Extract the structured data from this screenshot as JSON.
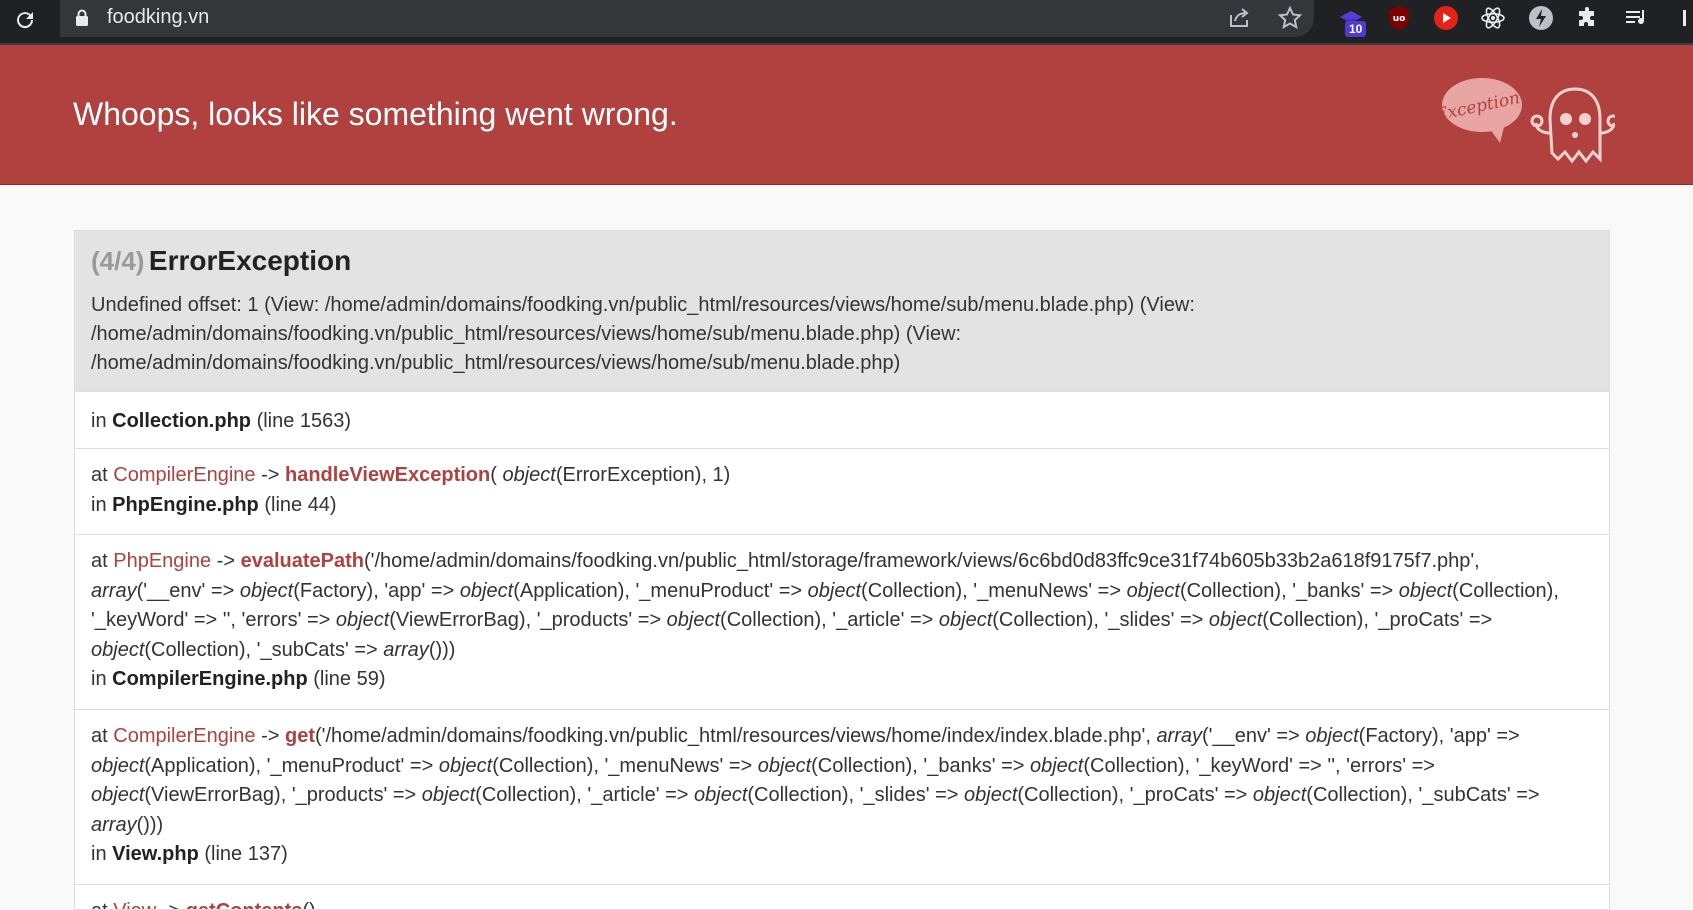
{
  "browser": {
    "url": "foodking.vn",
    "extension_badge": "10"
  },
  "header": {
    "title": "Whoops, looks like something went wrong.",
    "mascot_text": "Exception!"
  },
  "exception": {
    "counter": "(4/4)",
    "class": "ErrorException",
    "message": "Undefined offset: 1 (View: /home/admin/domains/foodking.vn/public_html/resources/views/home/sub/menu.blade.php) (View: /home/admin/domains/foodking.vn/public_html/resources/views/home/sub/menu.blade.php) (View: /home/admin/domains/foodking.vn/public_html/resources/views/home/sub/menu.blade.php)"
  },
  "trace": {
    "row1": {
      "in": "in ",
      "file": "Collection.php",
      "line": " (line 1563)"
    },
    "row2": {
      "at": "at ",
      "class": "CompilerEngine",
      "arrow": " -> ",
      "fn": "handleViewException",
      "args": "( object(ErrorException), 1)",
      "in": "in ",
      "file": "PhpEngine.php",
      "line": " (line 44)"
    },
    "row3": {
      "at": "at ",
      "class": "PhpEngine",
      "arrow": " -> ",
      "fn": "evaluatePath",
      "args": "('/home/admin/domains/foodking.vn/public_html/storage/framework/views/6c6bd0d83ffc9ce31f74b605b33b2a618f9175f7.php', array('__env' => object(Factory), 'app' => object(Application), '_menuProduct' => object(Collection), '_menuNews' => object(Collection), '_banks' => object(Collection), '_keyWord' => '', 'errors' => object(ViewErrorBag), '_products' => object(Collection), '_article' => object(Collection), '_slides' => object(Collection), '_proCats' => object(Collection), '_subCats' => array()))",
      "in": "in ",
      "file": "CompilerEngine.php",
      "line": " (line 59)"
    },
    "row4": {
      "at": "at ",
      "class": "CompilerEngine",
      "arrow": " -> ",
      "fn": "get",
      "args": "('/home/admin/domains/foodking.vn/public_html/resources/views/home/index/index.blade.php', array('__env' => object(Factory), 'app' => object(Application), '_menuProduct' => object(Collection), '_menuNews' => object(Collection), '_banks' => object(Collection), '_keyWord' => '', 'errors' => object(ViewErrorBag), '_products' => object(Collection), '_article' => object(Collection), '_slides' => object(Collection), '_proCats' => object(Collection), '_subCats' => array()))",
      "in": "in ",
      "file": "View.php",
      "line": " (line 137)"
    },
    "row5": {
      "at": "at ",
      "class": "View",
      "arrow": " -> ",
      "fn": "getContents",
      "args": "()"
    }
  }
}
